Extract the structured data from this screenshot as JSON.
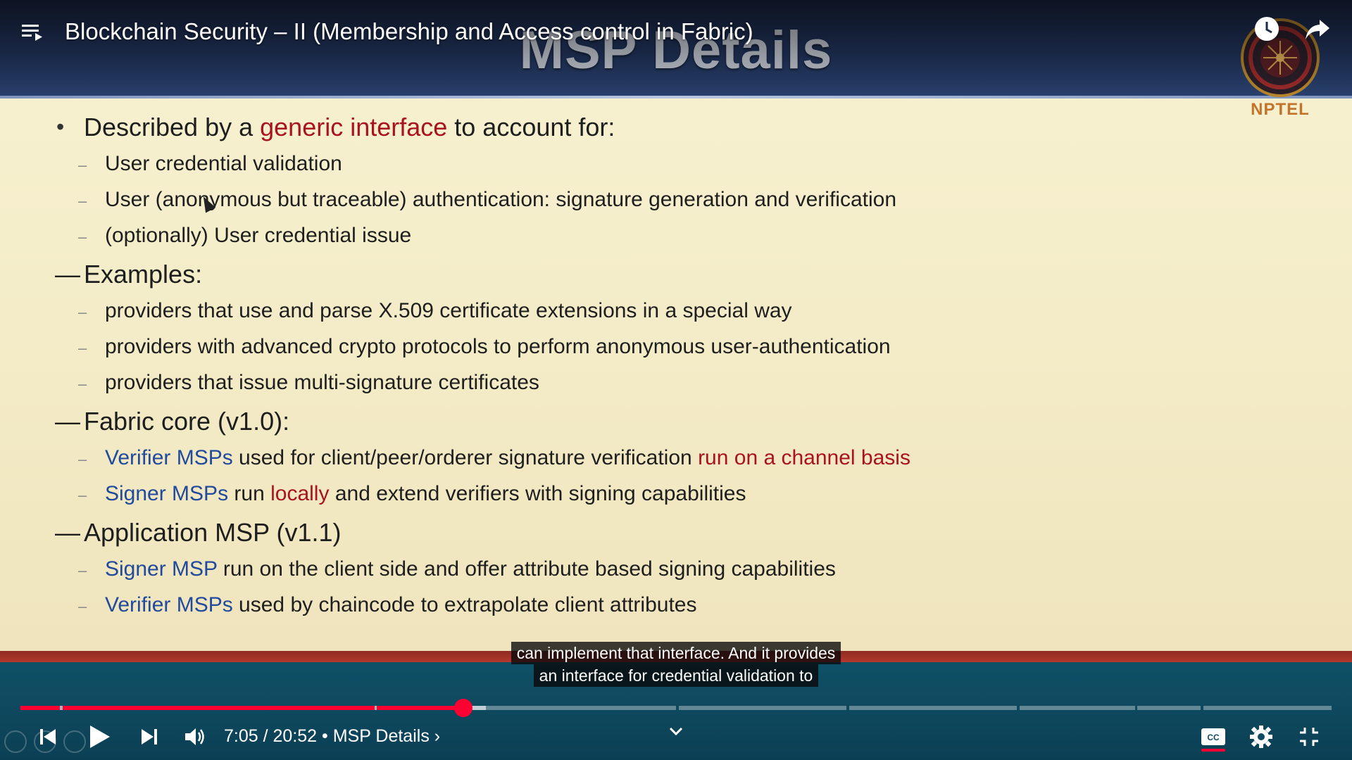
{
  "video": {
    "title": "Blockchain Security – II (Membership and Access control in Fabric)"
  },
  "slide": {
    "title": "MSP Details",
    "logo_text": "NPTEL",
    "lines": [
      {
        "level": 1,
        "bullet": "•",
        "parts": [
          {
            "text": "Described by a ",
            "style": "normal"
          },
          {
            "text": "generic interface",
            "style": "red"
          },
          {
            "text": " to account for:",
            "style": "normal"
          }
        ]
      },
      {
        "level": 2,
        "bullet": "–",
        "parts": [
          {
            "text": "User credential validation",
            "style": "normal"
          }
        ]
      },
      {
        "level": 2,
        "bullet": "–",
        "parts": [
          {
            "text": "User (anonymous but traceable) authentication: signature generation and verification",
            "style": "normal"
          }
        ]
      },
      {
        "level": 2,
        "bullet": "–",
        "parts": [
          {
            "text": "(optionally) User credential issue",
            "style": "normal"
          }
        ]
      },
      {
        "level": 1,
        "bullet": "—",
        "parts": [
          {
            "text": "Examples:",
            "style": "normal"
          }
        ]
      },
      {
        "level": 2,
        "bullet": "–",
        "parts": [
          {
            "text": "providers that use and parse X.509 certificate extensions in a special way",
            "style": "normal"
          }
        ]
      },
      {
        "level": 2,
        "bullet": "–",
        "parts": [
          {
            "text": "providers with advanced crypto protocols to perform anonymous user-authentication",
            "style": "normal"
          }
        ]
      },
      {
        "level": 2,
        "bullet": "–",
        "parts": [
          {
            "text": "providers that issue multi-signature certificates",
            "style": "normal"
          }
        ]
      },
      {
        "level": 1,
        "bullet": "—",
        "parts": [
          {
            "text": "Fabric core (v1.0):",
            "style": "normal"
          }
        ]
      },
      {
        "level": 2,
        "bullet": "–",
        "parts": [
          {
            "text": "Verifier MSPs",
            "style": "blue"
          },
          {
            "text": " used for client/peer/orderer signature verification ",
            "style": "normal"
          },
          {
            "text": "run on a channel basis",
            "style": "red"
          }
        ]
      },
      {
        "level": 2,
        "bullet": "–",
        "parts": [
          {
            "text": "Signer MSPs",
            "style": "blue"
          },
          {
            "text": " run ",
            "style": "normal"
          },
          {
            "text": "locally",
            "style": "red"
          },
          {
            "text": " and extend verifiers with signing capabilities",
            "style": "normal"
          }
        ]
      },
      {
        "level": 1,
        "bullet": "—",
        "parts": [
          {
            "text": "Application MSP (v1.1)",
            "style": "normal"
          }
        ]
      },
      {
        "level": 2,
        "bullet": "–",
        "parts": [
          {
            "text": "Signer MSP",
            "style": "blue"
          },
          {
            "text": " run on the client side and offer attribute based signing capabilities",
            "style": "normal"
          }
        ]
      },
      {
        "level": 2,
        "bullet": "–",
        "parts": [
          {
            "text": "Verifier MSPs",
            "style": "blue"
          },
          {
            "text": " used by chaincode to extrapolate client attributes",
            "style": "normal"
          }
        ]
      }
    ]
  },
  "captions": {
    "line1": "can implement that interface. And it provides",
    "line2": "an interface for credential validation to"
  },
  "player": {
    "current_time": "7:05",
    "duration": "20:52",
    "separator": " / ",
    "chapter": "• MSP Details",
    "chapter_chevron": "›",
    "expand_chevron": "⌄",
    "progress_played": 0.338,
    "progress_loaded": 0.355,
    "accent_color": "#ff0033",
    "settings_badge": "",
    "icons": [
      "playlist-icon",
      "watch-later-icon",
      "share-icon",
      "previous-icon",
      "play-icon",
      "next-icon",
      "volume-icon",
      "expand-chevron-icon",
      "captions-icon",
      "settings-icon",
      "exit-fullscreen-icon"
    ]
  }
}
